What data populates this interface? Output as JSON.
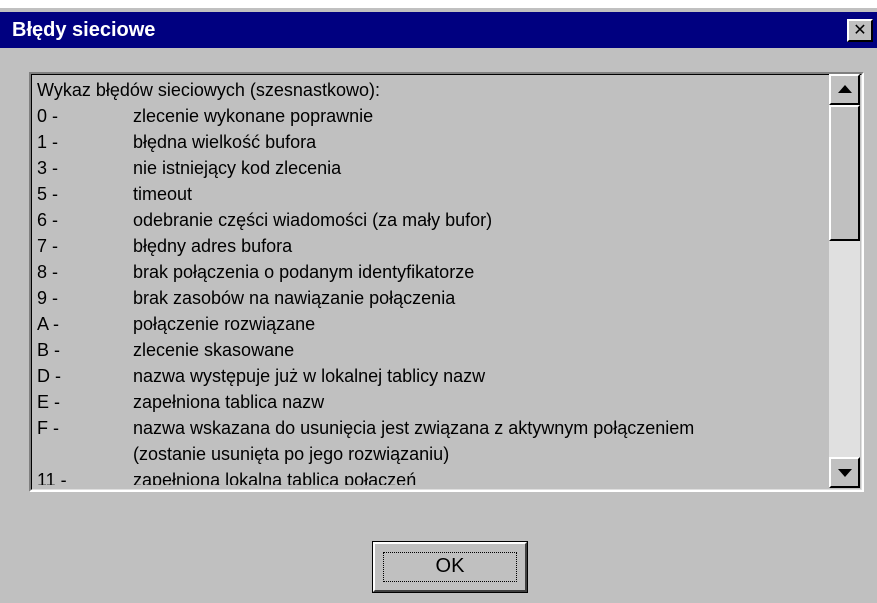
{
  "window": {
    "title": "Błędy sieciowe",
    "close_glyph": "✕"
  },
  "list": {
    "header": "Wykaz błędów sieciowych (szesnastkowo):",
    "items": [
      {
        "code": "0 -",
        "text": "zlecenie wykonane poprawnie"
      },
      {
        "code": "1 -",
        "text": "błędna wielkość bufora"
      },
      {
        "code": "3 -",
        "text": "nie istniejący kod zlecenia"
      },
      {
        "code": "5 -",
        "text": "timeout"
      },
      {
        "code": "6 -",
        "text": "odebranie części wiadomości (za mały bufor)"
      },
      {
        "code": "7 -",
        "text": "błędny adres bufora"
      },
      {
        "code": "8 -",
        "text": "brak połączenia o podanym identyfikatorze"
      },
      {
        "code": "9 -",
        "text": "brak zasobów na nawiązanie połączenia"
      },
      {
        "code": "A -",
        "text": "połączenie rozwiązane"
      },
      {
        "code": "B -",
        "text": "zlecenie skasowane"
      },
      {
        "code": "D -",
        "text": "nazwa występuje już w lokalnej tablicy nazw"
      },
      {
        "code": "E -",
        "text": "zapełniona tablica nazw"
      },
      {
        "code": "F -",
        "text": "nazwa wskazana do usunięcia jest związana z aktywnym połączeniem"
      },
      {
        "code": "",
        "text": "(zostanie usunięta po jego rozwiązaniu)"
      },
      {
        "code": "11 -",
        "text": "zapełniona lokalna tablica połączeń"
      }
    ]
  },
  "buttons": {
    "ok_label": "OK"
  },
  "colors": {
    "titlebar": "#000080",
    "face": "#c0c0c0"
  },
  "icons": {
    "close": "close-icon",
    "scroll_up": "arrow-up-icon",
    "scroll_down": "arrow-down-icon"
  }
}
